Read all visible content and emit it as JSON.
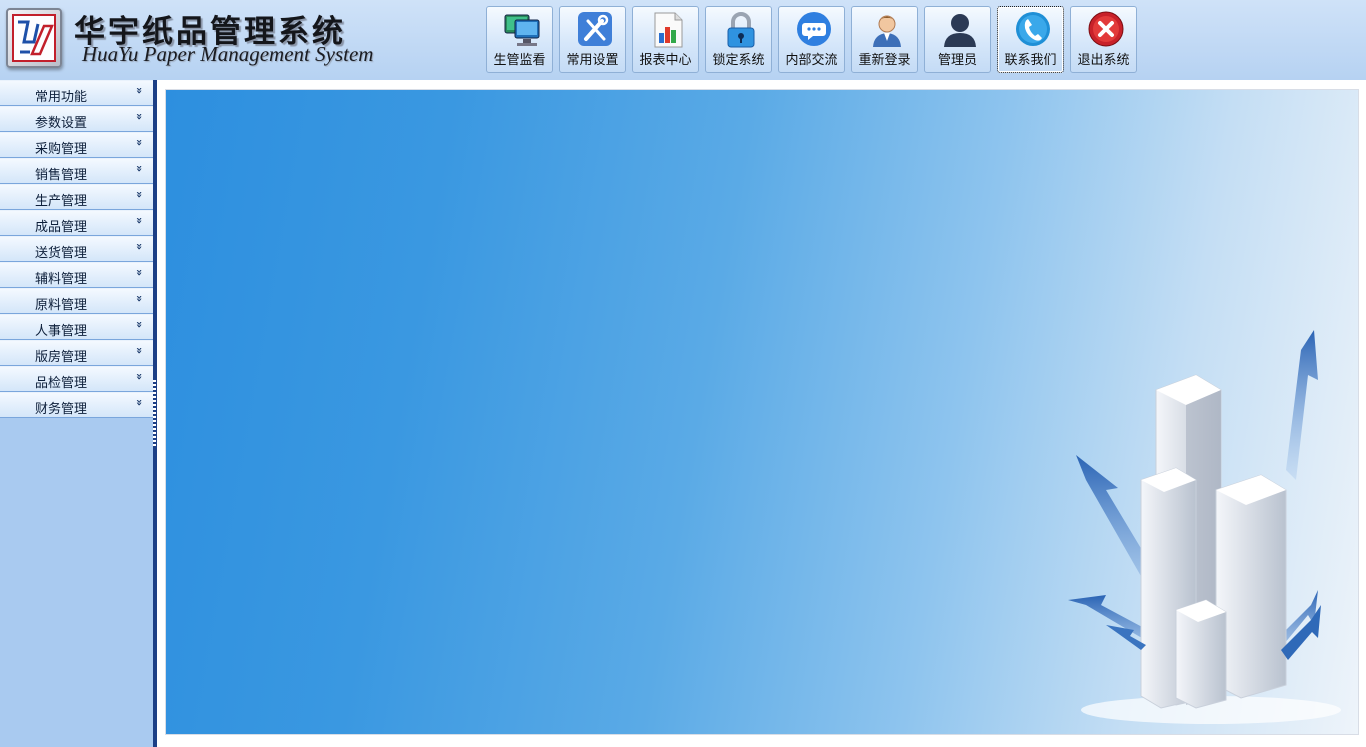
{
  "header": {
    "title_cn": "华宇纸品管理系统",
    "title_en": "HuaYu  Paper Management System",
    "logo_letters": "hy"
  },
  "toolbar": {
    "buttons": [
      {
        "label": "生管监看",
        "icon": "monitor-icon"
      },
      {
        "label": "常用设置",
        "icon": "tools-icon"
      },
      {
        "label": "报表中心",
        "icon": "report-icon"
      },
      {
        "label": "锁定系统",
        "icon": "lock-icon"
      },
      {
        "label": "内部交流",
        "icon": "chat-icon"
      },
      {
        "label": "重新登录",
        "icon": "user-icon"
      },
      {
        "label": "管理员",
        "icon": "admin-icon"
      },
      {
        "label": "联系我们",
        "icon": "phone-icon",
        "active": true
      },
      {
        "label": "退出系统",
        "icon": "exit-icon"
      }
    ]
  },
  "sidebar": {
    "items": [
      {
        "label": "常用功能"
      },
      {
        "label": "参数设置"
      },
      {
        "label": "采购管理"
      },
      {
        "label": "销售管理"
      },
      {
        "label": "生产管理"
      },
      {
        "label": "成品管理"
      },
      {
        "label": "送货管理"
      },
      {
        "label": "辅料管理"
      },
      {
        "label": "原料管理"
      },
      {
        "label": "人事管理"
      },
      {
        "label": "版房管理"
      },
      {
        "label": "品检管理"
      },
      {
        "label": "财务管理"
      }
    ],
    "chevron": "»"
  },
  "colors": {
    "header_bg": "#c4dcf5",
    "sidebar_bg": "#a9caf0",
    "splitter": "#1c3f86",
    "main_gradient_start": "#2d8fdf",
    "main_gradient_end": "#eef4fa"
  }
}
